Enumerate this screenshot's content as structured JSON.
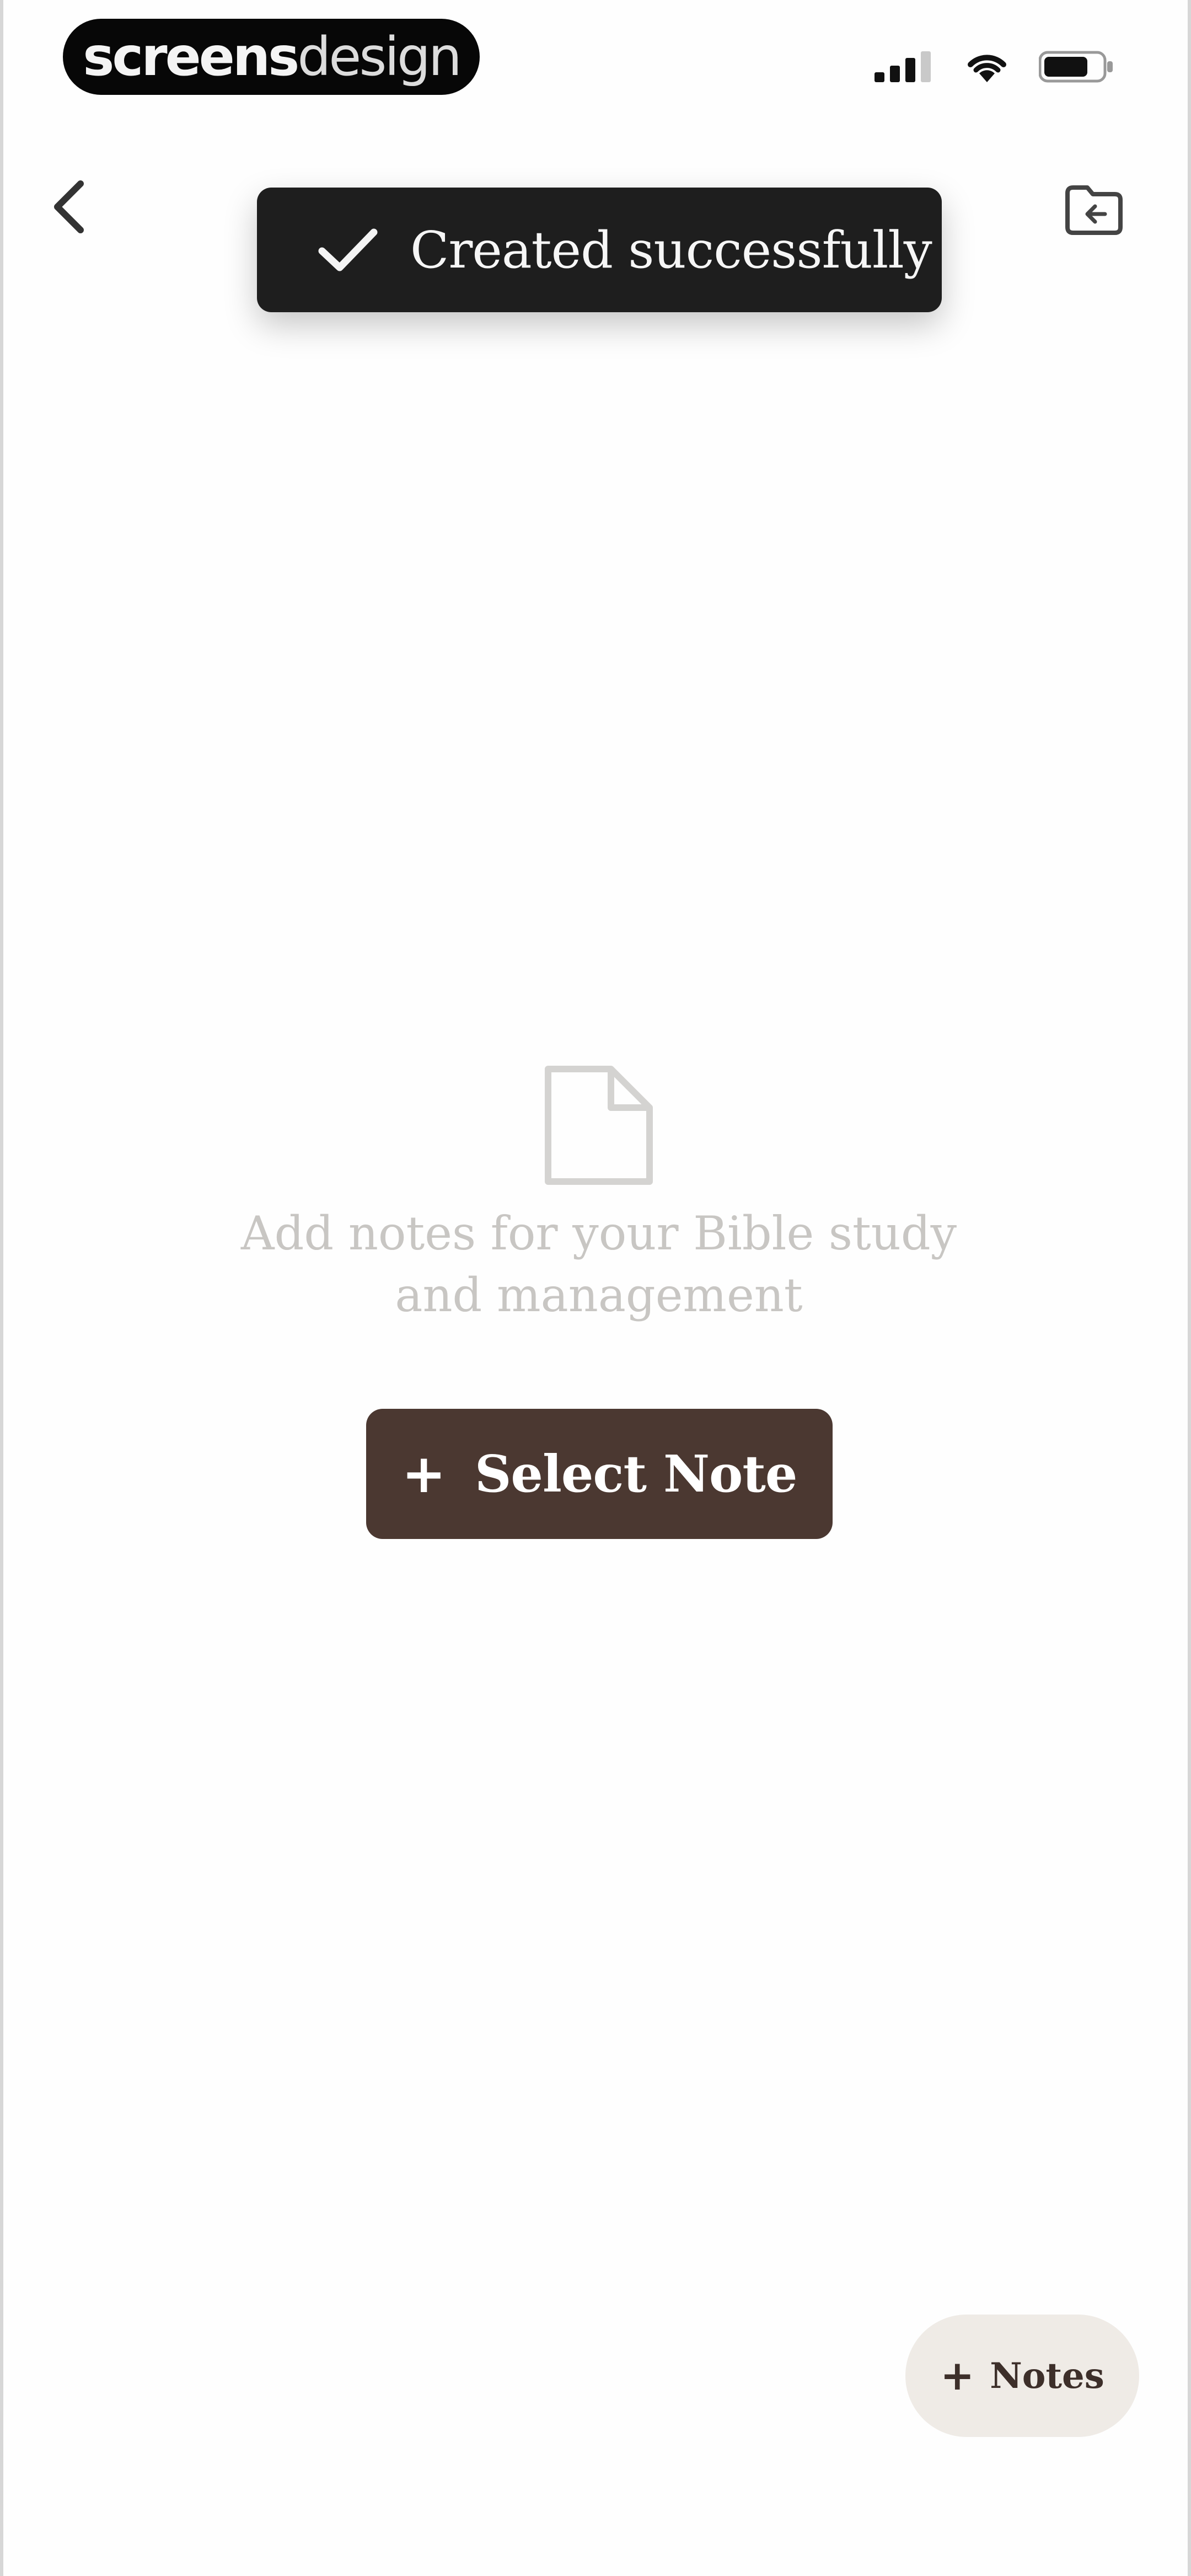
{
  "status_bar": {
    "brand_bold": "screens",
    "brand_light": "design",
    "icons": [
      "signal-icon",
      "wifi-icon",
      "battery-icon"
    ]
  },
  "nav": {
    "back_icon": "chevron-left-icon",
    "folder_icon": "folder-icon"
  },
  "toast": {
    "message": "Created successfully",
    "icon": "check-icon"
  },
  "empty_state": {
    "icon": "document-icon",
    "line1": "Add notes for your Bible study",
    "line2": "and management"
  },
  "select_button": {
    "plus": "+",
    "label": "Select Note"
  },
  "notes_fab": {
    "plus": "+",
    "label": "Notes"
  },
  "colors": {
    "toast_bg": "#1e1e1e",
    "primary_brown": "#4b3831",
    "fab_bg": "#efebe6",
    "muted_text": "#c8c6c3"
  }
}
